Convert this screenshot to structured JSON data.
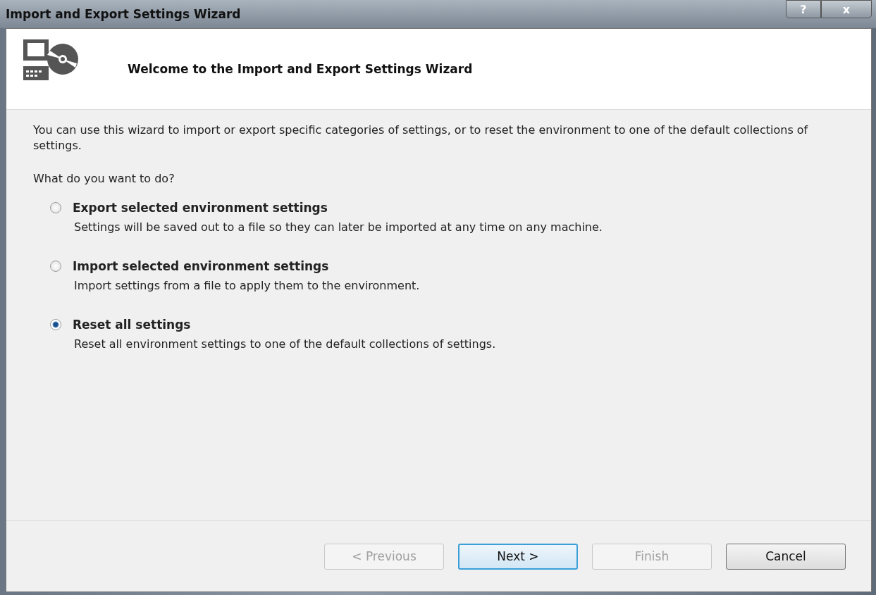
{
  "window": {
    "title": "Import and Export Settings Wizard",
    "help_button": "?",
    "close_button": "x"
  },
  "header": {
    "title": "Welcome to the Import and Export Settings Wizard"
  },
  "intro": "You can use this wizard to import or export specific categories of settings, or to reset the environment to one of the default collections of settings.",
  "question": "What do you want to do?",
  "options": [
    {
      "label": "Export selected environment settings",
      "description": "Settings will be saved out to a file so they can later be imported at any time on any machine.",
      "selected": false
    },
    {
      "label": "Import selected environment settings",
      "description": "Import settings from a file to apply them to the environment.",
      "selected": false
    },
    {
      "label": "Reset all settings",
      "description": "Reset all environment settings to one of the default collections of settings.",
      "selected": true
    }
  ],
  "buttons": [
    {
      "label": "< Previous",
      "disabled": true,
      "default": false
    },
    {
      "label": "Next >",
      "disabled": false,
      "default": true
    },
    {
      "label": "Finish",
      "disabled": true,
      "default": false
    },
    {
      "label": "Cancel",
      "disabled": false,
      "default": false
    }
  ]
}
